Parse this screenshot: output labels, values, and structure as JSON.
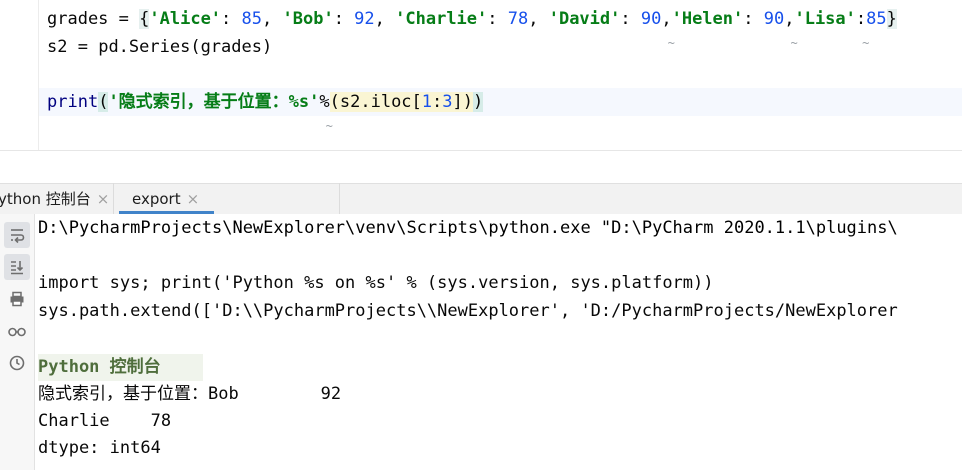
{
  "editor": {
    "line_grades": {
      "var": "grades",
      "op": " = ",
      "open": "{",
      "items": [
        {
          "key": "'Alice'",
          "val": "85"
        },
        {
          "key": "'Bob'",
          "val": "92"
        },
        {
          "key": "'Charlie'",
          "val": "78"
        },
        {
          "key": "'David'",
          "val": "90"
        },
        {
          "key": "'Helen'",
          "val": "90"
        },
        {
          "key": "'Lisa'",
          "val": "85"
        }
      ],
      "close": "}"
    },
    "line_series": {
      "var": "s2",
      "op": " = ",
      "call": "pd.Series(",
      "arg": "grades",
      "end": ")"
    },
    "line_print": {
      "func": "print",
      "open": "(",
      "string": "'隐式索引，基于位置：%s'",
      "percent": "%",
      "popen": "(",
      "expr_head": "s2.iloc[",
      "n1": "1",
      "colon": ":",
      "n2": "3",
      "expr_tail": "])",
      "close": ")"
    }
  },
  "tabs": [
    {
      "label": "ython 控制台",
      "active": false
    },
    {
      "label": "export",
      "active": true
    }
  ],
  "toolbar": {
    "icons": [
      "rerun-icon",
      "scroll-to-end-icon",
      "print-icon",
      "glasses-icon",
      "history-icon"
    ]
  },
  "console": {
    "lines": [
      "D:\\PycharmProjects\\NewExplorer\\venv\\Scripts\\python.exe \"D:\\PyCharm 2020.1.1\\plugins\\",
      "",
      "import sys; print('Python %s on %s' % (sys.version, sys.platform))",
      "sys.path.extend(['D:\\\\PycharmProjects\\\\NewExplorer', 'D:/PycharmProjects/NewExplorer",
      "",
      "Python 控制台",
      "隐式索引，基于位置：Bob        92",
      "Charlie    78",
      "dtype: int64"
    ]
  },
  "colors": {
    "string": "#067d17",
    "number": "#1750eb",
    "active_tab_underline": "#4083c9"
  }
}
